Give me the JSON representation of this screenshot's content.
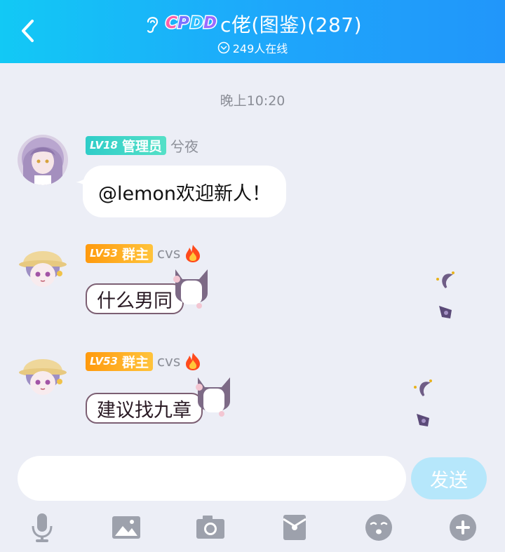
{
  "header": {
    "logo_letters": [
      "C",
      "P",
      "D",
      "D"
    ],
    "logo_colors": [
      "#ff5fa8",
      "#7a73ff",
      "#2fc2ff",
      "#9a6bff"
    ],
    "title": "c佬(图鉴)(287)",
    "online": "249人在线"
  },
  "chat": {
    "time": "晚上10:20",
    "messages": [
      {
        "level": "LV18",
        "role": "管理员",
        "name": "兮夜",
        "text": "@lemon欢迎新人！"
      },
      {
        "level": "LV53",
        "role": "群主",
        "name": "cvs",
        "text": "什么男同"
      },
      {
        "level": "LV53",
        "role": "群主",
        "name": "cvs",
        "text": "建议找九章"
      }
    ]
  },
  "input": {
    "placeholder": "",
    "send_label": "发送"
  },
  "toolbar": {
    "icons": [
      "microphone-icon",
      "image-icon",
      "camera-icon",
      "red-packet-icon",
      "emoji-icon",
      "plus-icon"
    ]
  },
  "colors": {
    "header_start": "#12c9f5",
    "header_end": "#2196fa",
    "admin_badge": "#2fcdc8",
    "owner_badge": "#ff9a0e",
    "send_disabled": "#b6e7fb"
  }
}
